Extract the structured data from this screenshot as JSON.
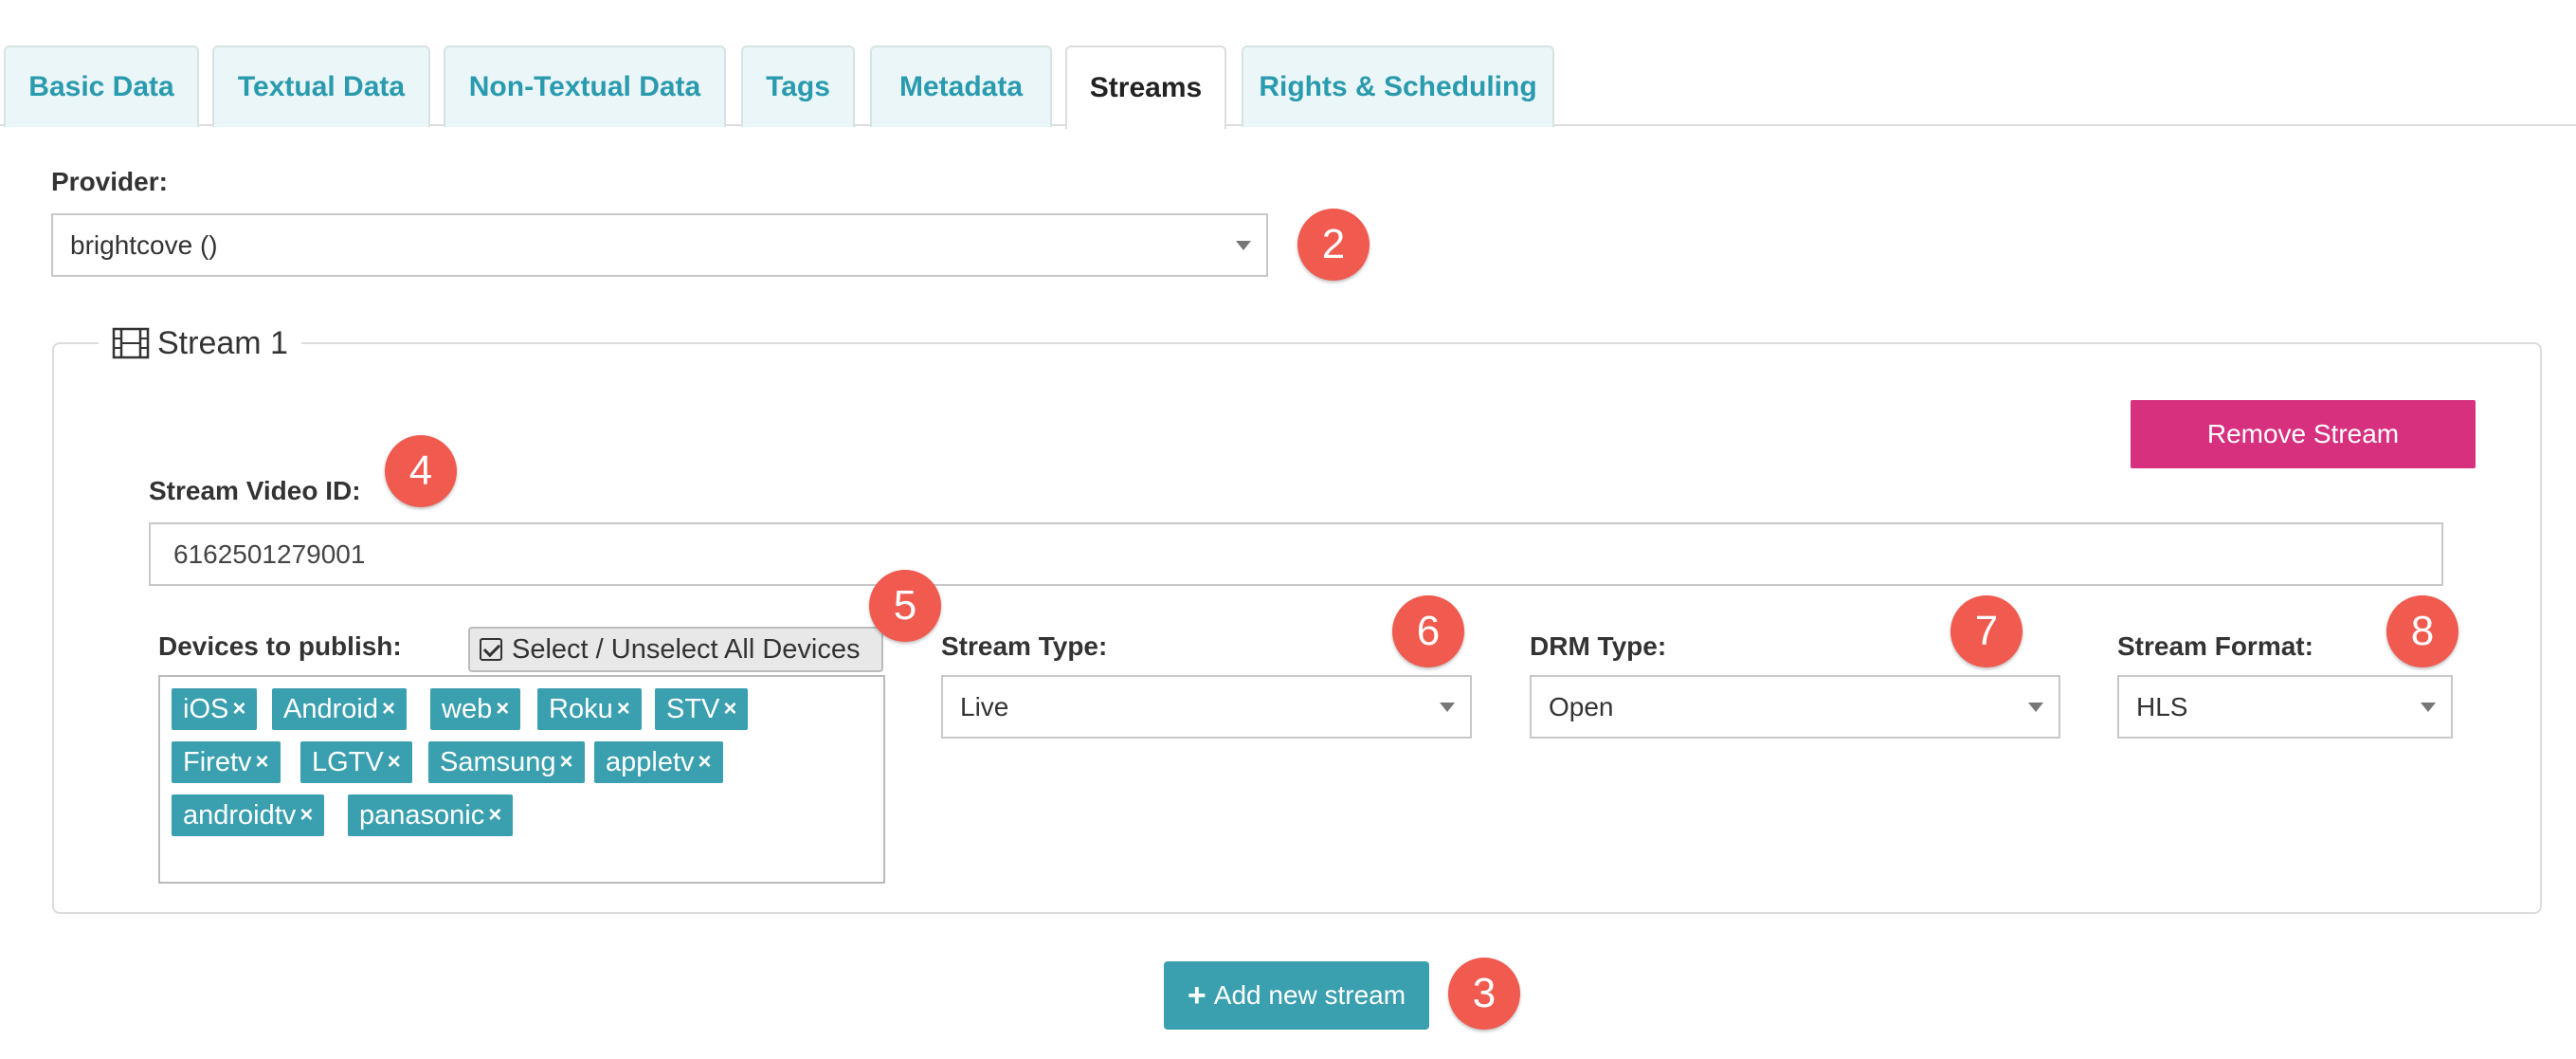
{
  "tabs": [
    {
      "label": "Basic Data",
      "active": false
    },
    {
      "label": "Textual Data",
      "active": false
    },
    {
      "label": "Non-Textual Data",
      "active": false
    },
    {
      "label": "Tags",
      "active": false
    },
    {
      "label": "Metadata",
      "active": false
    },
    {
      "label": "Streams",
      "active": true
    },
    {
      "label": "Rights & Scheduling",
      "active": false
    }
  ],
  "provider": {
    "label": "Provider:",
    "value": "brightcove ()"
  },
  "stream": {
    "legend": "Stream 1",
    "legend_icon": "film-icon",
    "remove_label": "Remove Stream",
    "video_id_label": "Stream Video ID:",
    "video_id_value": "6162501279001",
    "devices_label": "Devices to publish:",
    "select_all_label": "Select / Unselect All Devices",
    "devices": [
      "iOS",
      "Android",
      "web",
      "Roku",
      "STV",
      "Firetv",
      "LGTV",
      "Samsung",
      "appletv",
      "androidtv",
      "panasonic"
    ],
    "device_remove_symbol": "×",
    "stream_type": {
      "label": "Stream Type:",
      "value": "Live"
    },
    "drm_type": {
      "label": "DRM Type:",
      "value": "Open"
    },
    "stream_format": {
      "label": "Stream Format:",
      "value": "HLS"
    }
  },
  "add_stream_label": "Add new stream",
  "add_stream_icon": "plus-icon",
  "annotations": [
    "2",
    "3",
    "4",
    "5",
    "6",
    "7",
    "8"
  ],
  "colors": {
    "accent": "#3a9fae",
    "remove": "#d6307e",
    "badge": "#f05a4f",
    "tab_bg": "#eaf6f8",
    "tab_text": "#2a9aae"
  }
}
